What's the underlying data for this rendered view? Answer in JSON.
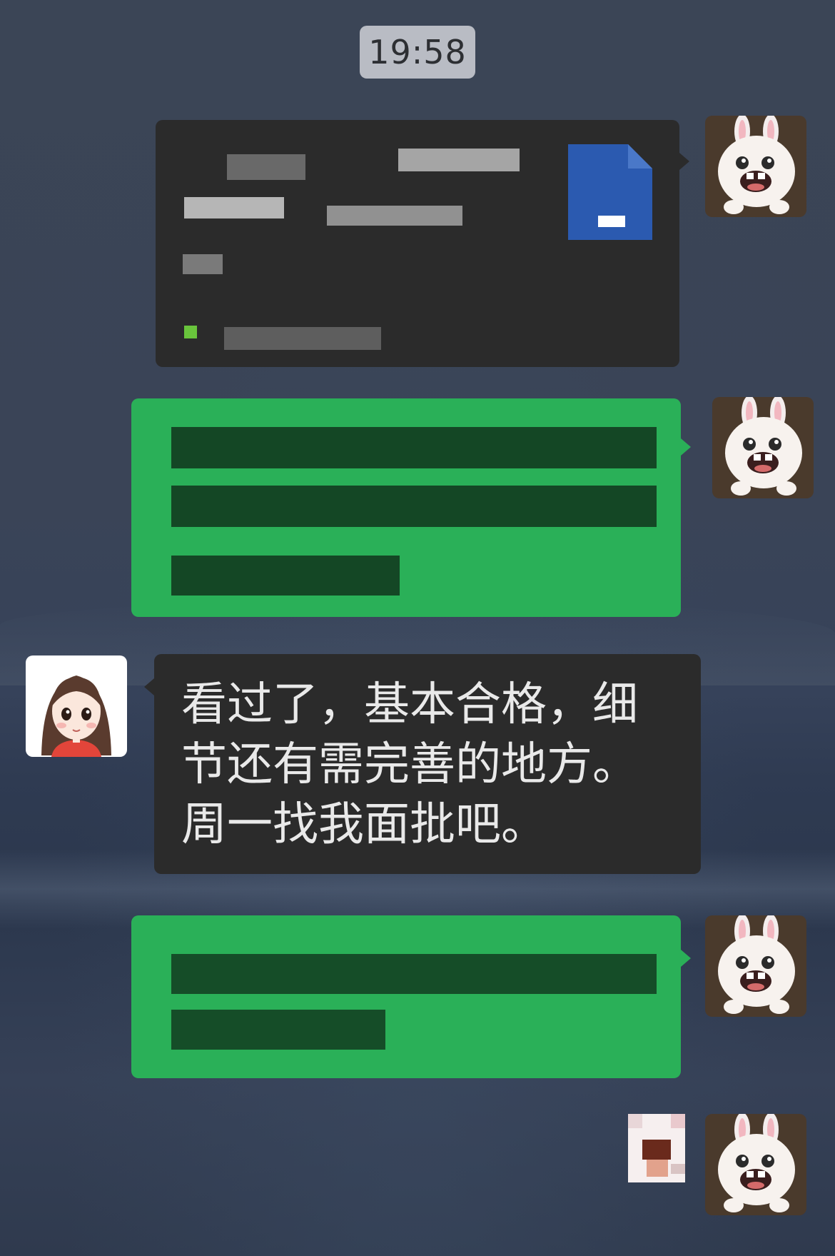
{
  "chat": {
    "timestamp": "19:58",
    "messages": [
      {
        "side": "right",
        "type": "file-card",
        "content": "",
        "bubble_color": "#2b2b2b"
      },
      {
        "side": "right",
        "type": "text",
        "content": "",
        "bubble_color": "#2ab058"
      },
      {
        "side": "left",
        "type": "text",
        "content": "看过了，基本合格，细节还有需完善的地方。周一找我面批吧。",
        "bubble_color": "#2b2b2b"
      },
      {
        "side": "right",
        "type": "text",
        "content": "",
        "bubble_color": "#2ab058"
      },
      {
        "side": "right",
        "type": "sticker",
        "content": ""
      }
    ],
    "avatars": {
      "self": "bunny-avatar",
      "other": "girl-avatar"
    }
  },
  "colors": {
    "green_bubble": "#2ab058",
    "dark_bubble": "#2b2b2b",
    "file_icon": "#2b5ab0",
    "time_badge": "#b9bcc4"
  }
}
